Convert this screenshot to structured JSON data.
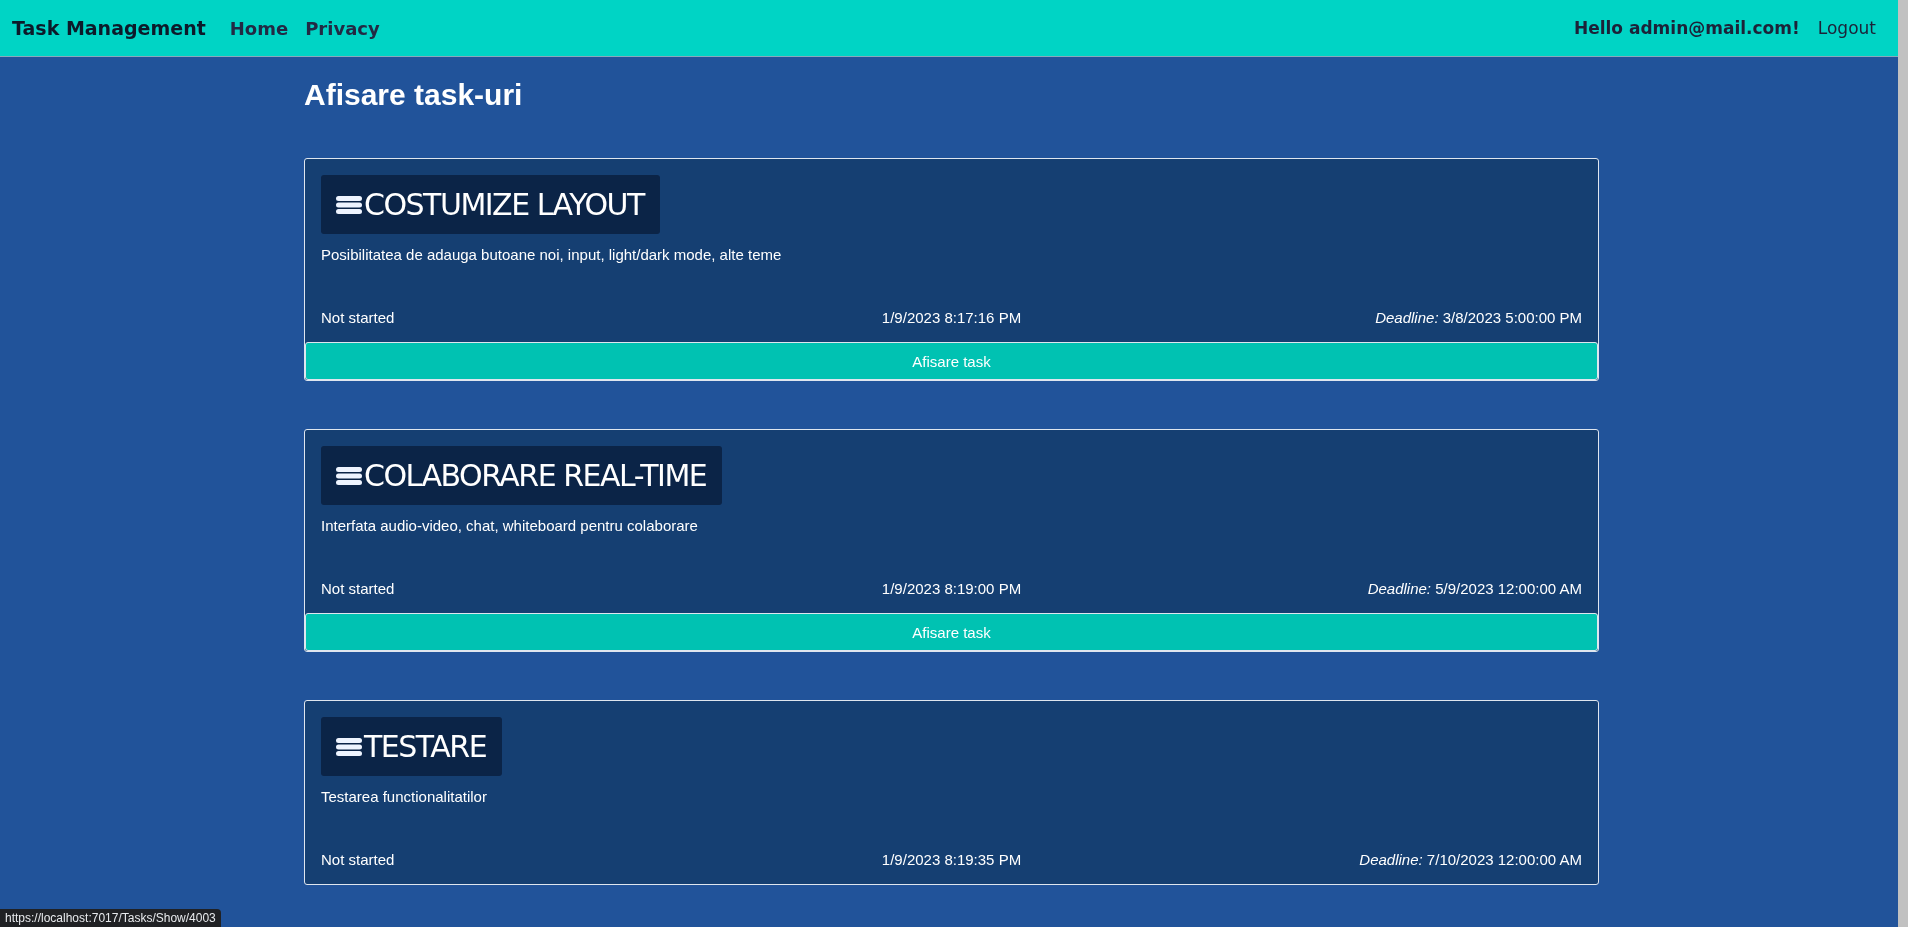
{
  "navbar": {
    "brand": "Task Management",
    "links": [
      {
        "label": "Home"
      },
      {
        "label": "Privacy"
      }
    ],
    "greeting": "Hello admin@mail.com!",
    "logout": "Logout"
  },
  "heading": "Afisare task-uri",
  "tasks": [
    {
      "title": "COSTUMIZE LAYOUT",
      "description": "Posibilitatea de adauga butoane noi, input, light/dark mode, alte teme",
      "status": "Not started",
      "created": "1/9/2023 8:17:16 PM",
      "deadline_label": "Deadline:",
      "deadline": "3/8/2023 5:00:00 PM",
      "button": "Afisare task"
    },
    {
      "title": "COLABORARE REAL-TIME",
      "description": "Interfata audio-video, chat, whiteboard pentru colaborare",
      "status": "Not started",
      "created": "1/9/2023 8:19:00 PM",
      "deadline_label": "Deadline:",
      "deadline": "5/9/2023 12:00:00 AM",
      "button": "Afisare task"
    },
    {
      "title": "TESTARE",
      "description": "Testarea functionalitatilor",
      "status": "Not started",
      "created": "1/9/2023 8:19:35 PM",
      "deadline_label": "Deadline:",
      "deadline": "7/10/2023 12:00:00 AM"
    }
  ],
  "status_url": "https://localhost:7017/Tasks/Show/4003"
}
